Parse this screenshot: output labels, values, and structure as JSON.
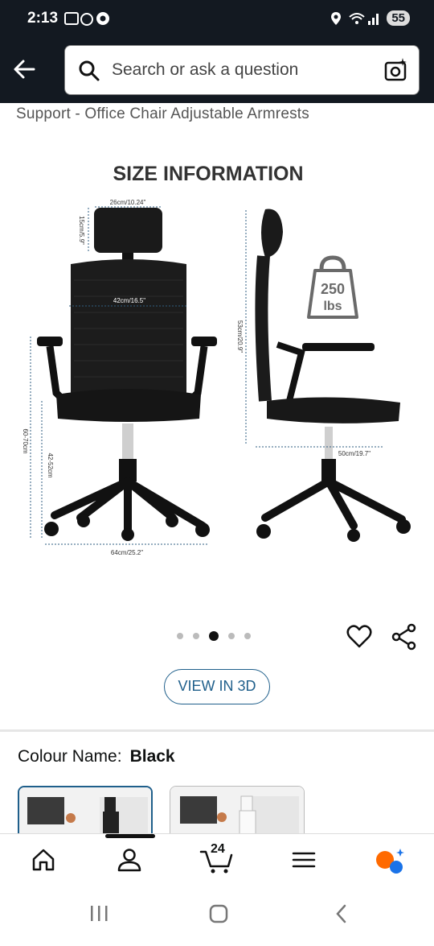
{
  "status": {
    "time": "2:13",
    "battery": "55"
  },
  "search": {
    "placeholder": "Search or ask a question"
  },
  "product": {
    "title_fragment": "Support - Office Chair Adjustable Armrests"
  },
  "image": {
    "heading": "SIZE INFORMATION",
    "dim_head_width": "26cm/10.24\"",
    "dim_head_height": "15cm/5.9\"",
    "dim_back_width": "42cm/16.5\"",
    "dim_total_height": "60-70cm",
    "dim_seat_height": "42-52cm",
    "dim_base_width": "64cm/25.2\"",
    "dim_back_height": "53cm/20.9\"",
    "dim_seat_depth": "50cm/19.7\"",
    "weight_value": "250",
    "weight_unit": "lbs"
  },
  "carousel": {
    "count": 5,
    "active_index": 2
  },
  "view3d": {
    "label": "VIEW IN 3D"
  },
  "colour": {
    "label": "Colour Name:",
    "value": "Black"
  },
  "nav": {
    "cart_count": "24"
  },
  "colors": {
    "header_bg": "#131921",
    "link": "#1f5f8b",
    "alexa_orange": "#ff6a00",
    "alexa_blue": "#1a73e8"
  },
  "icons": [
    "back-arrow-icon",
    "search-icon",
    "camera-icon",
    "heart-icon",
    "share-icon",
    "home-icon",
    "account-icon",
    "cart-icon",
    "menu-icon",
    "rufus-icon"
  ]
}
